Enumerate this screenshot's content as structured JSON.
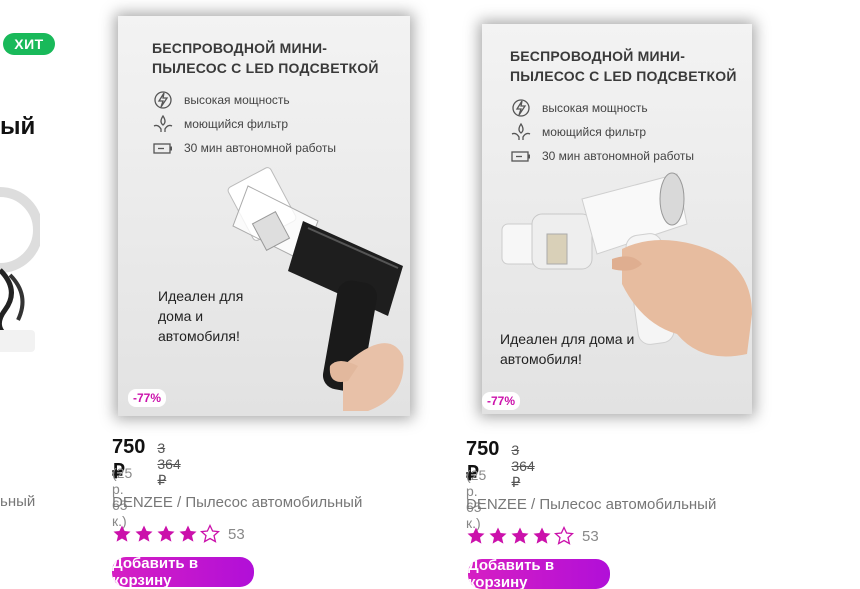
{
  "left_partial": {
    "badge": "ХИТ",
    "title_fragment": "ый",
    "brand_fragment": "ьный"
  },
  "products": [
    {
      "photo_title": "БЕСПРОВОДНОЙ МИНИ-\nПЫЛЕСОС С LED ПОДСВЕТКОЙ",
      "features": [
        "высокая мощность",
        "моющийся фильтр",
        "30 мин автономной работы"
      ],
      "photo_caption": "Идеален для\nдома и\nавтомобиля!",
      "device_color": "black",
      "discount": "-77%",
      "price": "750 ₽",
      "old_price": "3 364 ₽",
      "installment": "(25 р. 65 к.)",
      "brand": "DENZEE",
      "name": " / Пылесос автомобильный",
      "rating": 4,
      "reviews": "53",
      "button": "Добавить в корзину"
    },
    {
      "photo_title": "БЕСПРОВОДНОЙ МИНИ-\nПЫЛЕСОС С LED ПОДСВЕТКОЙ",
      "features": [
        "высокая мощность",
        "моющийся фильтр",
        "30 мин автономной работы"
      ],
      "photo_caption": "Идеален для дома и\nавтомобиля!",
      "device_color": "white",
      "discount": "-77%",
      "price": "750 ₽",
      "old_price": "3 364 ₽",
      "installment": "(25 р. 65 к.)",
      "brand": "DENZEE",
      "name": " / Пылесос автомобильный",
      "rating": 4,
      "reviews": "53",
      "button": "Добавить в корзину"
    }
  ],
  "colors": {
    "accent": "#cb11ab",
    "hit_green": "#19b95a",
    "star": "#cb11ab"
  }
}
